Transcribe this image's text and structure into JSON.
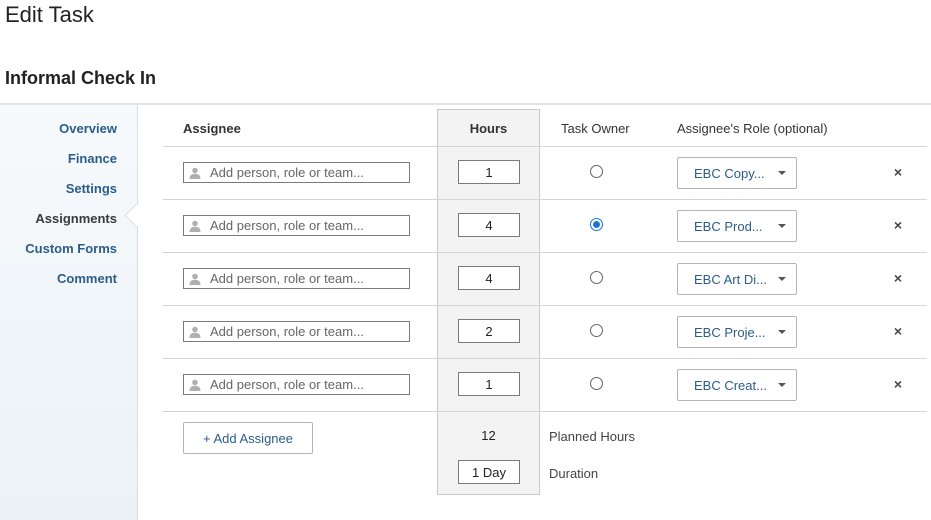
{
  "page": {
    "title": "Edit Task",
    "task_name": "Informal Check In"
  },
  "sidebar": {
    "items": [
      {
        "label": "Overview"
      },
      {
        "label": "Finance"
      },
      {
        "label": "Settings"
      },
      {
        "label": "Assignments"
      },
      {
        "label": "Custom Forms"
      },
      {
        "label": "Comment"
      }
    ],
    "active": "Assignments"
  },
  "table": {
    "headers": {
      "assignee": "Assignee",
      "hours": "Hours",
      "task_owner": "Task Owner",
      "role": "Assignee's Role (optional)"
    },
    "rows": [
      {
        "assignee_placeholder": "Add person, role or team...",
        "hours": "1",
        "owner": false,
        "role": "EBC Copy..."
      },
      {
        "assignee_placeholder": "Add person, role or team...",
        "hours": "4",
        "owner": true,
        "role": "EBC Prod..."
      },
      {
        "assignee_placeholder": "Add person, role or team...",
        "hours": "4",
        "owner": false,
        "role": "EBC Art Di..."
      },
      {
        "assignee_placeholder": "Add person, role or team...",
        "hours": "2",
        "owner": false,
        "role": "EBC Proje..."
      },
      {
        "assignee_placeholder": "Add person, role or team...",
        "hours": "1",
        "owner": false,
        "role": "EBC Creat..."
      }
    ],
    "remove_symbol": "×"
  },
  "footer": {
    "add_assignee_label": "+ Add Assignee",
    "planned_hours_value": "12",
    "planned_hours_label": "Planned Hours",
    "duration_value": "1 Day",
    "duration_label": "Duration"
  },
  "colors": {
    "link_blue": "#2b5c8a",
    "radio_selected": "#1a73d9"
  },
  "icons": {
    "assignee_field": "person-icon",
    "remove": "close-icon",
    "dropdown": "chevron-down-icon"
  }
}
